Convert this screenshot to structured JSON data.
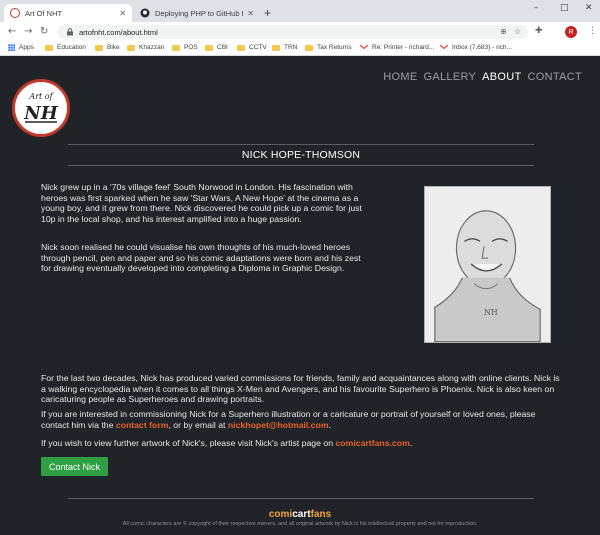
{
  "browser": {
    "tabs": [
      {
        "title": "Art Of NHT",
        "active": true
      },
      {
        "title": "Deploying PHP to GitHub Pages",
        "active": false
      }
    ],
    "url": "artofnht.com/about.html",
    "profile_initial": "R",
    "bookmarks": [
      "Apps",
      "Education",
      "Bike",
      "Khazzan",
      "POS",
      "CBI",
      "CCTV",
      "TRN",
      "Tax Returns",
      "Re: Printer - richard...",
      "Inbox (7,683) - rich..."
    ]
  },
  "site": {
    "nav": [
      "HOME",
      "GALLERY",
      "ABOUT",
      "CONTACT"
    ],
    "active_nav": "ABOUT",
    "logo_text_top": "Art of",
    "logo_text_main": "NH"
  },
  "about": {
    "heading": "NICK HOPE-THOMSON",
    "p1": "Nick grew up in a '70s village feel' South Norwood in London. His fascination with heroes was first sparked when he saw 'Star Wars, A New Hope' at the cinema as a young boy, and it grew from there. Nick discovered he could pick up a comic for just 10p in the local shop, and his interest amplified into a huge passion.",
    "p2": "Nick soon realised he could visualise his own thoughts of his much-loved heroes through pencil, pen and paper and so his comic adaptations were born and his zest for drawing eventually developed into completing a Diploma in Graphic Design.",
    "p3": "For the last two decades, Nick has produced varied commissions for friends, family and acquaintances along with online clients. Nick is a walking encyclopedia when it comes to all things X-Men and Avengers, and his favourite Superhero is Phoenix. Nick is also keen on caricaturing people as Superheroes and drawing portraits.",
    "p4_before": "If you are interested in commissioning Nick for a Superhero illustration or a caricature or portrait of yourself or loved ones, please contact him via the ",
    "p4_link1": "contact form",
    "p4_middle": ", or by email at ",
    "p4_link2": "nickhopet@hotmail.com",
    "p4_after": ".",
    "p5_before": "If you wish to view further artwork of Nick's, please visit Nick's artist page on ",
    "p5_link": "comicartfans.com",
    "p5_after": ".",
    "contact_button": "Contact Nick"
  },
  "footer": {
    "logo_part1": "comi",
    "logo_part2": "cart",
    "logo_part3": "fans",
    "note": "All comic characters are © copyright of their respective owners, and all original artwork by Nick is his intellectual property and not for reproduction."
  },
  "colors": {
    "accent": "#e8632b",
    "button": "#2ea043",
    "background": "#202327"
  }
}
